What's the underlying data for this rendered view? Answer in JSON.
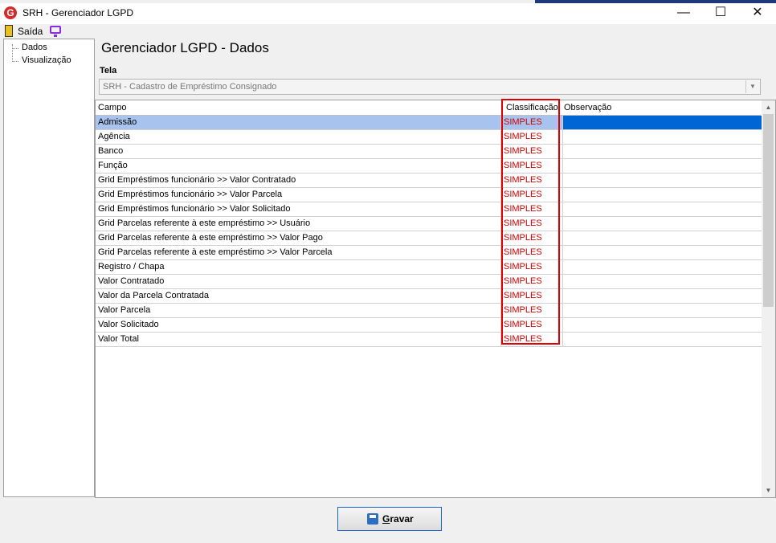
{
  "window": {
    "app_icon_letter": "G",
    "title": "SRH - Gerenciador LGPD",
    "minimize_glyph": "—",
    "maximize_glyph": "☐",
    "close_glyph": "✕"
  },
  "menu": {
    "exit_label": "Saída"
  },
  "tree": {
    "items": [
      "Dados",
      "Visualização"
    ]
  },
  "page": {
    "heading": "Gerenciador LGPD - Dados",
    "tela_label": "Tela",
    "tela_value": "SRH - Cadastro de Empréstimo Consignado"
  },
  "grid": {
    "columns": [
      "Campo",
      "Classificação",
      "Observação"
    ],
    "rows": [
      {
        "campo": "Admissão",
        "classificacao": "SIMPLES",
        "observacao": ""
      },
      {
        "campo": "Agência",
        "classificacao": "SIMPLES",
        "observacao": ""
      },
      {
        "campo": "Banco",
        "classificacao": "SIMPLES",
        "observacao": ""
      },
      {
        "campo": "Função",
        "classificacao": "SIMPLES",
        "observacao": ""
      },
      {
        "campo": "Grid Empréstimos funcionário >> Valor Contratado",
        "classificacao": "SIMPLES",
        "observacao": ""
      },
      {
        "campo": "Grid Empréstimos funcionário >> Valor Parcela",
        "classificacao": "SIMPLES",
        "observacao": ""
      },
      {
        "campo": "Grid Empréstimos funcionário >> Valor Solicitado",
        "classificacao": "SIMPLES",
        "observacao": ""
      },
      {
        "campo": "Grid Parcelas referente à este empréstimo >> Usuário",
        "classificacao": "SIMPLES",
        "observacao": ""
      },
      {
        "campo": "Grid Parcelas referente à este empréstimo >> Valor Pago",
        "classificacao": "SIMPLES",
        "observacao": ""
      },
      {
        "campo": "Grid Parcelas referente à este empréstimo >> Valor Parcela",
        "classificacao": "SIMPLES",
        "observacao": ""
      },
      {
        "campo": "Registro / Chapa",
        "classificacao": "SIMPLES",
        "observacao": ""
      },
      {
        "campo": "Valor Contratado",
        "classificacao": "SIMPLES",
        "observacao": ""
      },
      {
        "campo": "Valor da Parcela Contratada",
        "classificacao": "SIMPLES",
        "observacao": ""
      },
      {
        "campo": "Valor Parcela",
        "classificacao": "SIMPLES",
        "observacao": ""
      },
      {
        "campo": "Valor Solicitado",
        "classificacao": "SIMPLES",
        "observacao": ""
      },
      {
        "campo": "Valor Total",
        "classificacao": "SIMPLES",
        "observacao": ""
      }
    ],
    "selected_row": 0
  },
  "footer": {
    "save_label_underlined": "G",
    "save_label_rest": "ravar"
  },
  "colors": {
    "selection": "#a8c4ee",
    "selection_obs": "#0066d6",
    "class_text": "#d00000",
    "highlight_box": "#e00000"
  }
}
